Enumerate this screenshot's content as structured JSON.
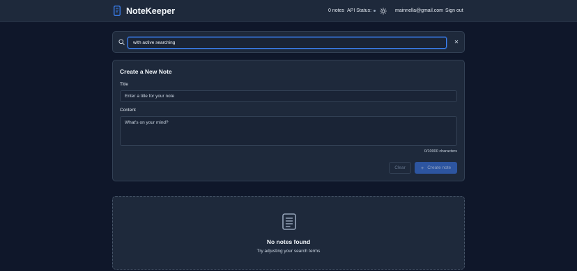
{
  "header": {
    "app_title": "NoteKeeper",
    "notes_count": "0 notes",
    "api_status_label": "API Status:",
    "user_email": "mainnella@gmail.com",
    "sign_out_label": "Sign out",
    "icons": [
      "notebook-icon",
      "sun-icon"
    ]
  },
  "search": {
    "value": "with active searching",
    "clear_glyph": "✕"
  },
  "create_note": {
    "heading": "Create a New Note",
    "title_label": "Title",
    "title_placeholder": "Enter a title for your note",
    "content_label": "Content",
    "content_placeholder": "What's on your mind?",
    "char_count": "0/10000 characters",
    "clear_label": "Clear",
    "create_label": "Create note",
    "create_glyph": "+"
  },
  "empty_state": {
    "title": "No notes found",
    "subtitle": "Try adjusting your search terms"
  },
  "colors": {
    "background": "#0f172a",
    "card": "#1e293b",
    "accent": "#3b82f6",
    "button_primary": "#2d55a0"
  }
}
